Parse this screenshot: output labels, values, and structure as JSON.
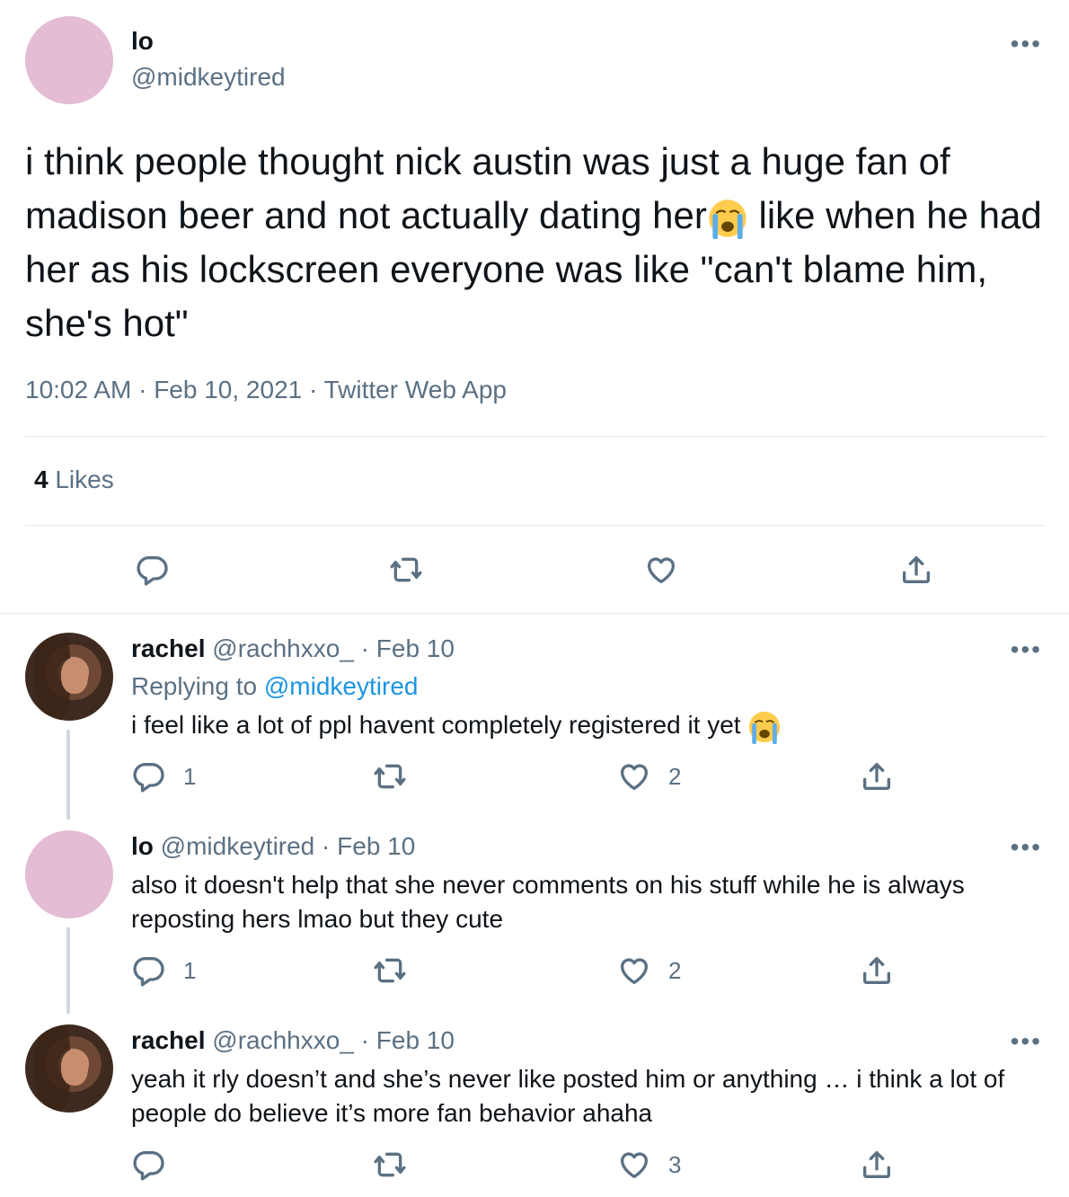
{
  "main_tweet": {
    "name": "lo",
    "handle": "@midkeytired",
    "more_icon": "more-horizontal-icon",
    "text_before_emoji": "i think people thought nick austin was just a huge fan of madison beer and not actually dating her",
    "emoji": "loudly-crying-face",
    "text_after_emoji": " like when he had her as his lockscreen everyone was like \"can't blame him, she's hot\"",
    "time": "10:02 AM",
    "date": "Feb 10, 2021",
    "source": "Twitter Web App",
    "likes_count": "4",
    "likes_label": "Likes"
  },
  "replies": [
    {
      "name": "rachel",
      "handle": "@rachhxxo_",
      "date": "Feb 10",
      "replying_label": "Replying to",
      "replying_to": "@midkeytired",
      "text": "i feel like a lot of ppl havent completely registered it yet ",
      "emoji": "loudly-crying-face",
      "reply_count": "1",
      "like_count": "2"
    },
    {
      "name": "lo",
      "handle": "@midkeytired",
      "date": "Feb 10",
      "text": "also it doesn't help that she never comments on his stuff while he is always reposting hers lmao but they cute",
      "reply_count": "1",
      "like_count": "2"
    },
    {
      "name": "rachel",
      "handle": "@rachhxxo_",
      "date": "Feb 10",
      "text": "yeah it rly doesn’t and she’s never like posted him or anything … i think a lot of people do believe it’s more fan behavior ahaha",
      "like_count": "3"
    }
  ],
  "separator": " · ",
  "colors": {
    "secondary": "#5b7083",
    "link": "#1b95e0",
    "avatar_pink": "#e4bcd3"
  }
}
